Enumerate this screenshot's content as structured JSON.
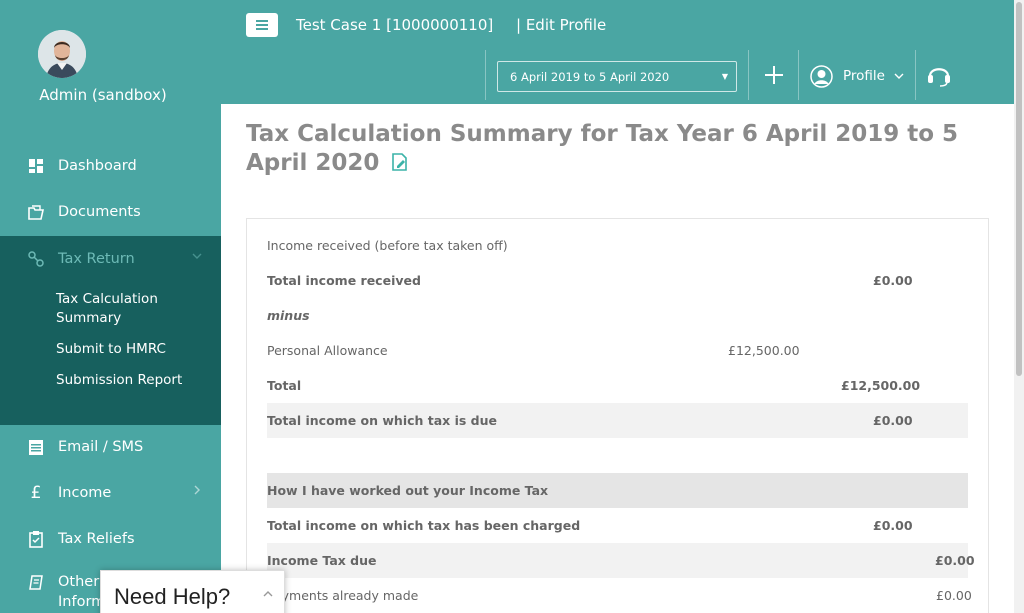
{
  "user": {
    "name": "Admin (sandbox)"
  },
  "sidebar": {
    "items": [
      {
        "label": "Dashboard"
      },
      {
        "label": "Documents"
      },
      {
        "label": "Tax Return"
      },
      {
        "label": "Email / SMS"
      },
      {
        "label": "Income"
      },
      {
        "label": "Tax Reliefs"
      },
      {
        "label": "Other Information"
      }
    ],
    "tax_return_sub": [
      {
        "label": "Tax Calculation Summary"
      },
      {
        "label": "Submit to HMRC"
      },
      {
        "label": "Submission Report"
      }
    ]
  },
  "header": {
    "case_title": "Test Case 1 [1000000110]",
    "edit_profile": "| Edit Profile",
    "year_select": "6 April 2019 to 5 April 2020",
    "profile_label": "Profile"
  },
  "main": {
    "title": "Tax Calculation Summary for Tax Year 6 April 2019 to 5 April 2020",
    "rows": [
      {
        "label": "Income received (before tax taken off)",
        "mid": "",
        "value": ""
      },
      {
        "label": "Total income received",
        "mid": "",
        "value": "£0.00"
      },
      {
        "label": "minus",
        "mid": "",
        "value": ""
      },
      {
        "label": "Personal Allowance",
        "mid": "£12,500.00",
        "value": ""
      },
      {
        "label": "Total",
        "mid": "",
        "value": "£12,500.00"
      },
      {
        "label": "Total income on which tax is due",
        "mid": "",
        "value": "£0.00"
      },
      {
        "label": "How I have worked out your Income Tax",
        "mid": "",
        "value": ""
      },
      {
        "label": "Total income on which tax has been charged",
        "mid": "",
        "value": "£0.00"
      },
      {
        "label": "Income Tax due",
        "mid": "",
        "value": "£0.00"
      },
      {
        "label": "Payments already made",
        "mid": "",
        "value": "£0.00"
      }
    ]
  },
  "help": {
    "label": "Need Help?"
  },
  "colors": {
    "brand": "#4aa6a3",
    "brand_dark": "#17605e",
    "title_gray": "#8a8a8a"
  }
}
